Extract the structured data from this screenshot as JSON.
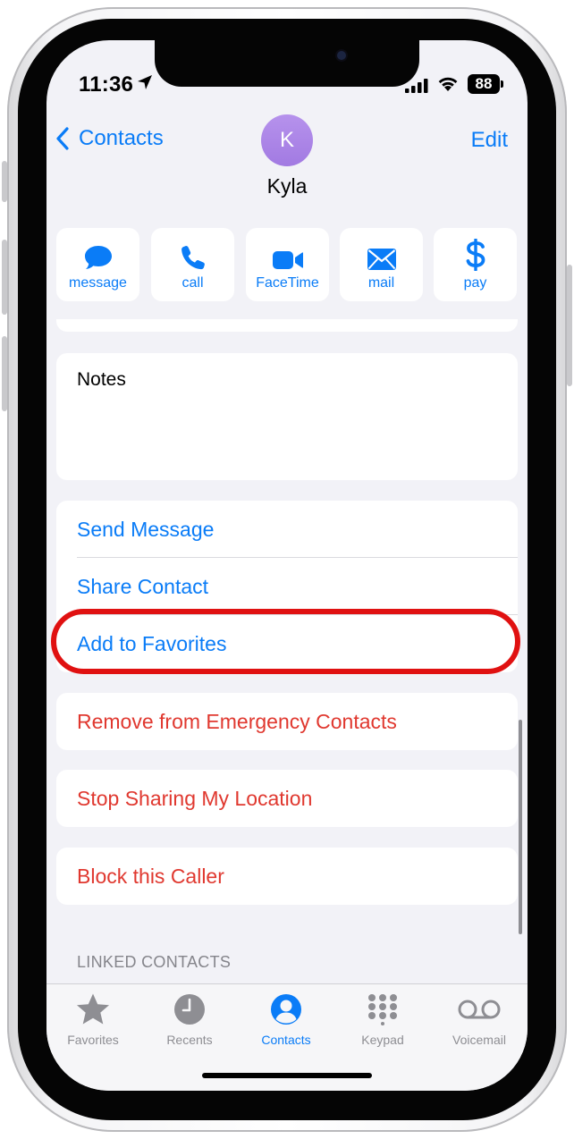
{
  "status_bar": {
    "time": "11:36",
    "battery": "88"
  },
  "nav": {
    "back_label": "Contacts",
    "edit_label": "Edit"
  },
  "contact": {
    "initial": "K",
    "name": "Kyla"
  },
  "actions": [
    {
      "label": "message",
      "icon": "message-bubble-icon"
    },
    {
      "label": "call",
      "icon": "phone-icon"
    },
    {
      "label": "FaceTime",
      "icon": "video-camera-icon"
    },
    {
      "label": "mail",
      "icon": "envelope-icon"
    },
    {
      "label": "pay",
      "icon": "dollar-sign-icon"
    }
  ],
  "notes": {
    "label": "Notes"
  },
  "options": {
    "send_message": "Send Message",
    "share_contact": "Share Contact",
    "add_to_favorites": "Add to Favorites"
  },
  "emergency": {
    "remove": "Remove from Emergency Contacts"
  },
  "location": {
    "stop_sharing": "Stop Sharing My Location"
  },
  "block": {
    "label": "Block this Caller"
  },
  "linked_contacts": {
    "header": "LINKED CONTACTS"
  },
  "tab_bar": {
    "tabs": [
      {
        "label": "Favorites",
        "icon": "star-icon"
      },
      {
        "label": "Recents",
        "icon": "clock-icon"
      },
      {
        "label": "Contacts",
        "icon": "person-circle-icon",
        "active": true
      },
      {
        "label": "Keypad",
        "icon": "keypad-icon"
      },
      {
        "label": "Voicemail",
        "icon": "voicemail-icon"
      }
    ]
  },
  "colors": {
    "accent": "#0a7cf7",
    "destructive": "#e0382f",
    "highlight": "#e01111",
    "avatar": "#a982e6"
  }
}
